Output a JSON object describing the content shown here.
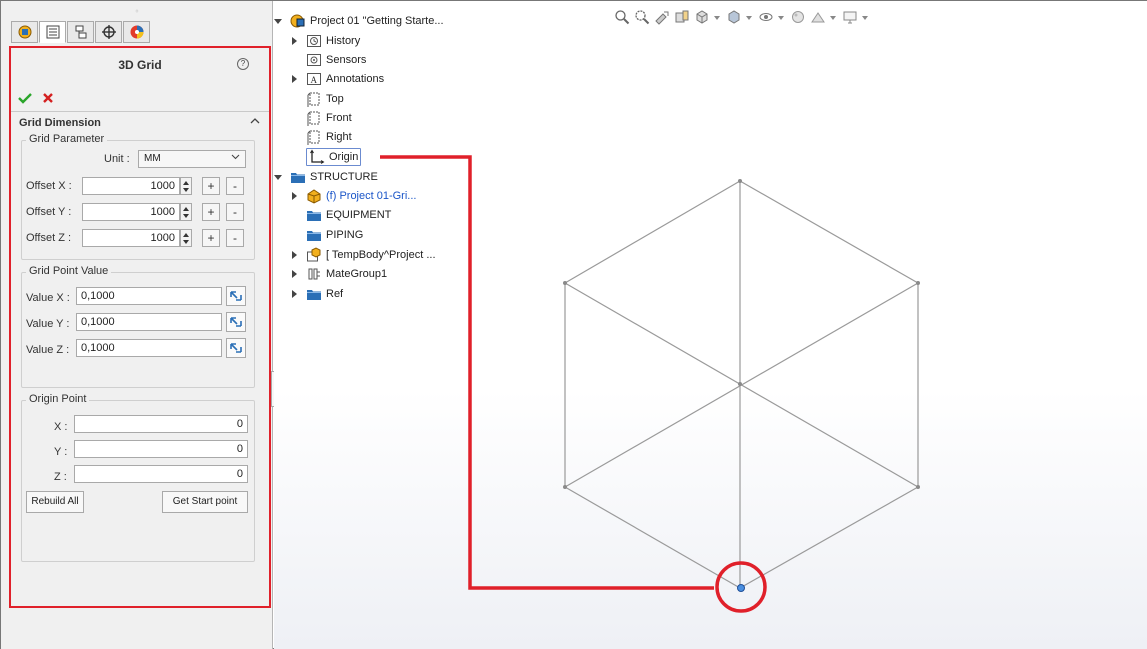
{
  "panel": {
    "title": "3D Grid",
    "help_glyph": "?",
    "group_label": "Grid Dimension",
    "grid_parameter": {
      "legend": "Grid Parameter",
      "unit_label": "Unit :",
      "unit_value": "MM",
      "rows": [
        {
          "label": "Offset X :",
          "value": "1000",
          "plus": "+",
          "minus": "-"
        },
        {
          "label": "Offset Y :",
          "value": "1000",
          "plus": "+",
          "minus": "-"
        },
        {
          "label": "Offset Z :",
          "value": "1000",
          "plus": "+",
          "minus": "-"
        }
      ]
    },
    "grid_point_value": {
      "legend": "Grid Point Value",
      "rows": [
        {
          "label": "Value X :",
          "value": "0,1000"
        },
        {
          "label": "Value Y :",
          "value": "0,1000"
        },
        {
          "label": "Value Z :",
          "value": "0,1000"
        }
      ]
    },
    "origin_point": {
      "legend": "Origin Point",
      "rows": [
        {
          "label": "X :",
          "value": "0"
        },
        {
          "label": "Y :",
          "value": "0"
        },
        {
          "label": "Z :",
          "value": "0"
        }
      ],
      "rebuild_label": "Rebuild All",
      "start_label": "Get Start point"
    }
  },
  "tabs": [
    "feature-manager-icon",
    "property-manager-icon",
    "configuration-manager-icon",
    "dim-xpert-icon",
    "display-manager-icon"
  ],
  "tree": {
    "root": "Project 01 \"Getting Starte...",
    "items": [
      {
        "label": "History"
      },
      {
        "label": "Sensors"
      },
      {
        "label": "Annotations"
      },
      {
        "label": "Top"
      },
      {
        "label": "Front"
      },
      {
        "label": "Right"
      },
      {
        "label": "Origin"
      },
      {
        "label": "STRUCTURE"
      },
      {
        "label": "(f) Project 01-Gri..."
      },
      {
        "label": "EQUIPMENT"
      },
      {
        "label": "PIPING"
      },
      {
        "label": "[ TempBody^Project ..."
      },
      {
        "label": "MateGroup1"
      },
      {
        "label": "Ref"
      }
    ]
  },
  "colors": {
    "highlight": "#e0202a",
    "accept": "#2aa52a",
    "reject": "#d42020",
    "folder": "#2b6fb6",
    "origin_point": "#4a8fe0",
    "grid_lines": "#9a9a9a"
  }
}
